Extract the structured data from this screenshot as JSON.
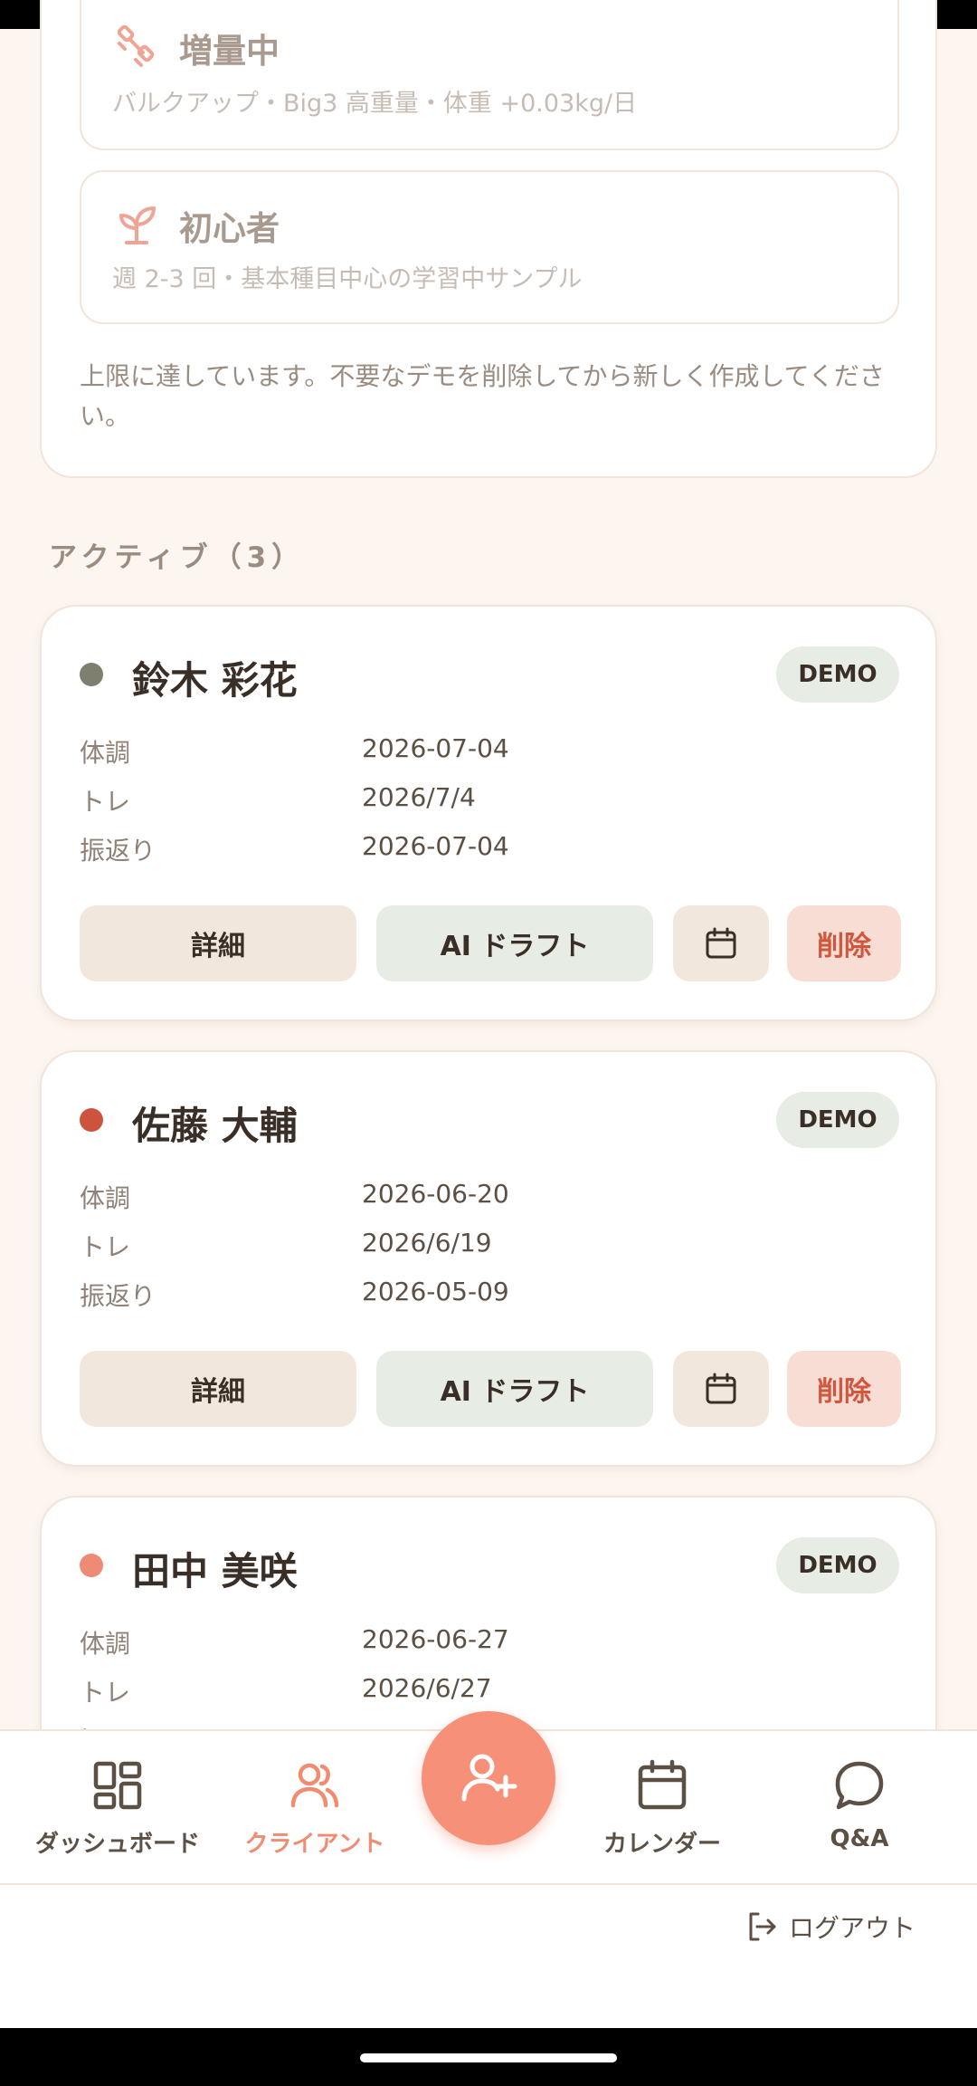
{
  "templates": {
    "option1": {
      "title": "増量中",
      "subtitle": "バルクアップ・Big3 高重量・体重 +0.03kg/日",
      "icon": "dumbbell-icon"
    },
    "option2": {
      "title": "初心者",
      "subtitle": "週 2-3 回・基本種目中心の学習中サンプル",
      "icon": "sprout-icon"
    },
    "limit_note": "上限に達しています。不要なデモを削除してから新しく作成してください。"
  },
  "section": {
    "heading": "アクティブ（3）"
  },
  "labels": {
    "condition": "体調",
    "training": "トレ",
    "review": "振返り",
    "detail_button": "詳細",
    "ai_draft_button": "AI ドラフト",
    "delete_button": "削除",
    "demo_badge": "DEMO"
  },
  "clients": [
    {
      "name": "鈴木 彩花",
      "status_color": "#7f7f6f",
      "condition": "2026-07-04",
      "training": "2026/7/4",
      "review": "2026-07-04"
    },
    {
      "name": "佐藤 大輔",
      "status_color": "#cd533d",
      "condition": "2026-06-20",
      "training": "2026/6/19",
      "review": "2026-05-09"
    },
    {
      "name": "田中 美咲",
      "status_color": "#ee8a76",
      "condition": "2026-06-27",
      "training": "2026/6/27",
      "review": ""
    }
  ],
  "nav": {
    "dashboard": "ダッシュボード",
    "clients": "クライアント",
    "calendar": "カレンダー",
    "qa": "Q&A",
    "active": "clients"
  },
  "logout": {
    "label": "ログアウト"
  },
  "colors": {
    "accent": "#f69079",
    "background": "#fdf6f0",
    "danger": "#d0573d"
  }
}
